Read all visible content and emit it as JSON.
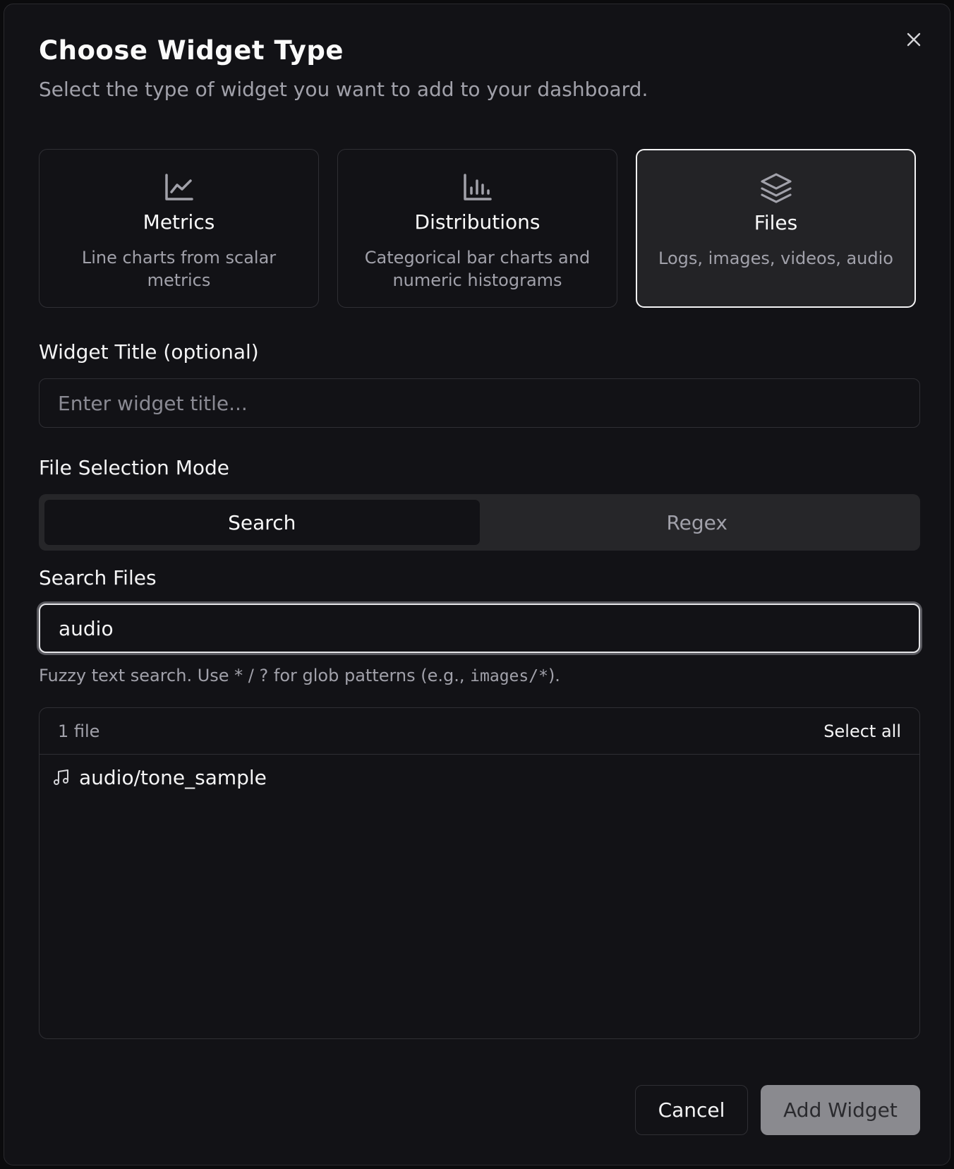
{
  "dialog": {
    "title": "Choose Widget Type",
    "subtitle": "Select the type of widget you want to add to your dashboard.",
    "close_icon": "close-icon"
  },
  "widget_types": [
    {
      "icon": "line-chart-icon",
      "title": "Metrics",
      "description": "Line charts from scalar metrics",
      "selected": false
    },
    {
      "icon": "bar-chart-icon",
      "title": "Distributions",
      "description": "Categorical bar charts and numeric histograms",
      "selected": false
    },
    {
      "icon": "layers-icon",
      "title": "Files",
      "description": "Logs, images, videos, audio",
      "selected": true
    }
  ],
  "widget_title": {
    "label": "Widget Title (optional)",
    "placeholder": "Enter widget title...",
    "value": ""
  },
  "selection_mode": {
    "label": "File Selection Mode",
    "options": [
      "Search",
      "Regex"
    ],
    "active": "Search"
  },
  "search_files": {
    "label": "Search Files",
    "value": "audio",
    "hint_prefix": "Fuzzy text search. Use * / ? for glob patterns (e.g., ",
    "hint_code": "images/*",
    "hint_suffix": ")."
  },
  "file_list": {
    "count_label": "1 file",
    "select_all_label": "Select all",
    "files": [
      {
        "icon": "music-note-icon",
        "name": "audio/tone_sample"
      }
    ]
  },
  "actions": {
    "cancel_label": "Cancel",
    "add_label": "Add Widget"
  },
  "colors": {
    "background": "#121216",
    "border": "#2f2f34",
    "selected_card": "#232326",
    "muted_text": "#a1a1aa",
    "disabled_button": "#8a8a8f"
  }
}
